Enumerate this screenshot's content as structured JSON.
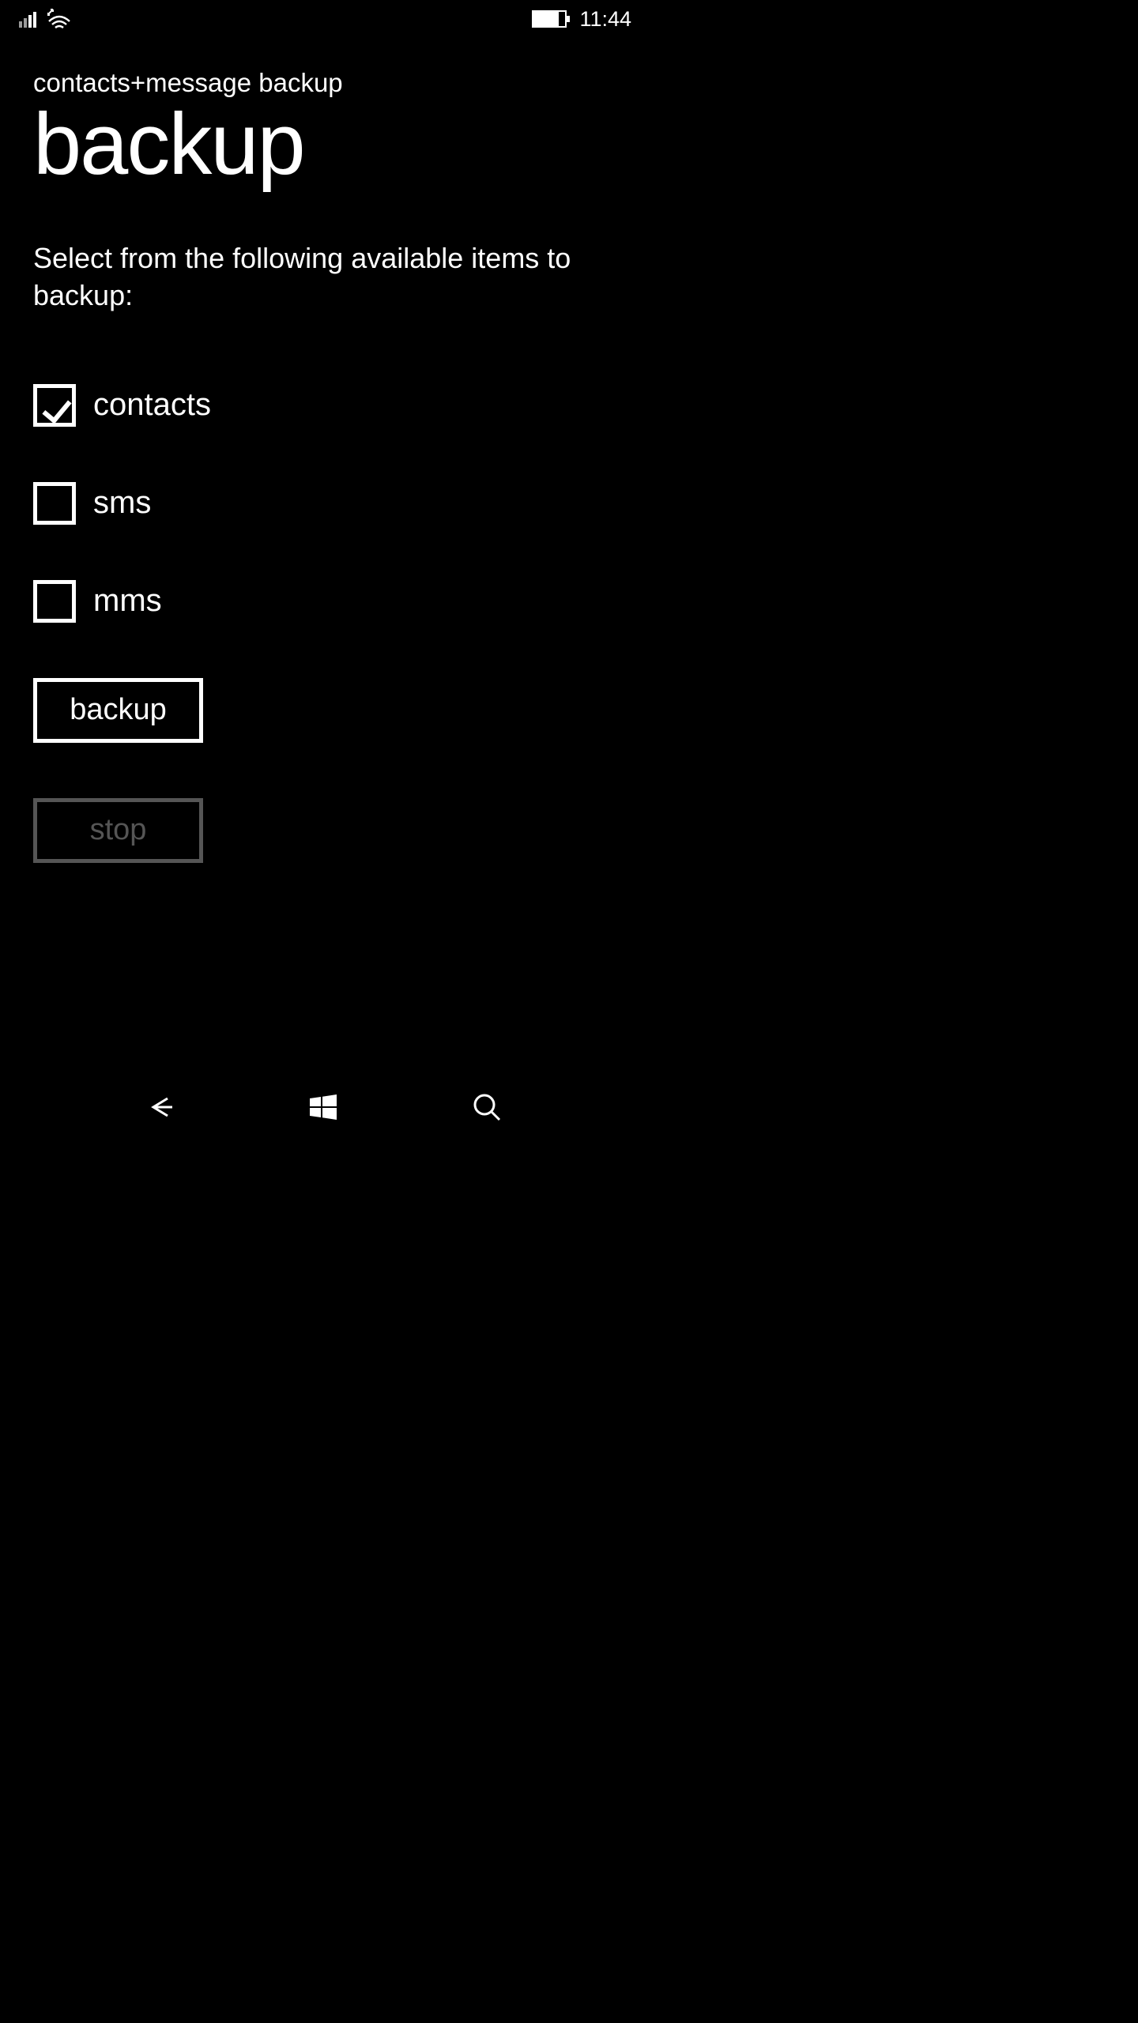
{
  "status_bar": {
    "time": "11:44"
  },
  "header": {
    "app_title": "contacts+message backup",
    "page_title": "backup"
  },
  "description": "Select from the following available items to backup:",
  "checkboxes": [
    {
      "label": "contacts",
      "checked": true
    },
    {
      "label": "sms",
      "checked": false
    },
    {
      "label": "mms",
      "checked": false
    }
  ],
  "buttons": {
    "backup": "backup",
    "stop": "stop"
  }
}
